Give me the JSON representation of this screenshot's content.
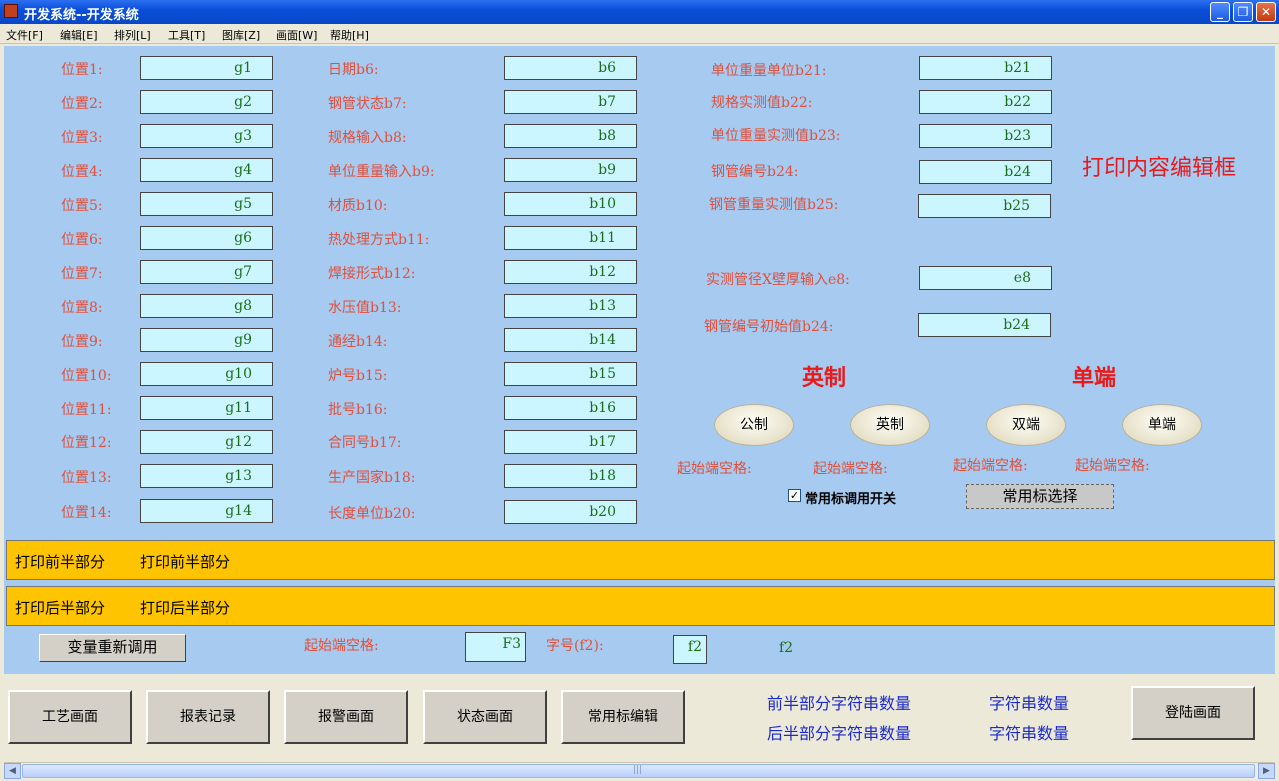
{
  "window": {
    "title": "开发系统--开发系统",
    "min": "_",
    "max": "❐",
    "close": "✕"
  },
  "menu": [
    "文件[F]",
    "编辑[E]",
    "排列[L]",
    "工具[T]",
    "图库[Z]",
    "画面[W]",
    "帮助[H]"
  ],
  "col1": [
    {
      "label": "位置1:",
      "value": "g1"
    },
    {
      "label": "位置2:",
      "value": "g2"
    },
    {
      "label": "位置3:",
      "value": "g3"
    },
    {
      "label": "位置4:",
      "value": "g4"
    },
    {
      "label": "位置5:",
      "value": "g5"
    },
    {
      "label": "位置6:",
      "value": "g6"
    },
    {
      "label": "位置7:",
      "value": "g7"
    },
    {
      "label": "位置8:",
      "value": "g8"
    },
    {
      "label": "位置9:",
      "value": "g9"
    },
    {
      "label": "位置10:",
      "value": "g10"
    },
    {
      "label": "位置11:",
      "value": "g11"
    },
    {
      "label": "位置12:",
      "value": "g12"
    },
    {
      "label": "位置13:",
      "value": "g13"
    },
    {
      "label": "位置14:",
      "value": "g14"
    }
  ],
  "col2": [
    {
      "label": "日期b6:",
      "value": "b6"
    },
    {
      "label": "钢管状态b7:",
      "value": "b7"
    },
    {
      "label": "规格输入b8:",
      "value": "b8"
    },
    {
      "label": "单位重量输入b9:",
      "value": "b9"
    },
    {
      "label": "材质b10:",
      "value": "b10"
    },
    {
      "label": "热处理方式b11:",
      "value": "b11"
    },
    {
      "label": "焊接形式b12:",
      "value": "b12"
    },
    {
      "label": "水压值b13:",
      "value": "b13"
    },
    {
      "label": "通经b14:",
      "value": "b14"
    },
    {
      "label": "炉号b15:",
      "value": "b15"
    },
    {
      "label": "批号b16:",
      "value": "b16"
    },
    {
      "label": "合同号b17:",
      "value": "b17"
    },
    {
      "label": "生产国家b18:",
      "value": "b18"
    },
    {
      "label": "长度单位b20:",
      "value": "b20"
    }
  ],
  "col3": [
    {
      "label": "单位重量单位b21:",
      "value": "b21"
    },
    {
      "label": "规格实测值b22:",
      "value": "b22"
    },
    {
      "label": "单位重量实测值b23:",
      "value": "b23"
    },
    {
      "label": "钢管编号b24:",
      "value": "b24"
    },
    {
      "label": "钢管重量实测值b25:",
      "value": "b25"
    },
    {
      "label": "实测管径X壁厚输入e8:",
      "value": "e8"
    },
    {
      "label": "钢管编号初始值b24:",
      "value": "b24"
    }
  ],
  "editor_title": "打印内容编辑框",
  "unit_title": "英制",
  "end_title": "单端",
  "ovals": [
    "公制",
    "英制",
    "双端",
    "单端"
  ],
  "space_labels": [
    "起始端空格:",
    "起始端空格:",
    "起始端空格:",
    "起始端空格:"
  ],
  "checkbox": {
    "label": "常用标调用开关",
    "mark": "✓"
  },
  "select_button": "常用标选择",
  "band_front": {
    "a": "打印前半部分",
    "b": "打印前半部分"
  },
  "band_back": {
    "a": "打印后半部分",
    "b": "打印后半部分"
  },
  "bottom": {
    "reload_button": "变量重新调用",
    "space_label": "起始端空格:",
    "space_value": "F3",
    "font_label": "字号(f2):",
    "font_value": "f2",
    "font_readout": "f2"
  },
  "nav_buttons": [
    "工艺画面",
    "报表记录",
    "报警画面",
    "状态画面",
    "常用标编辑"
  ],
  "counts": {
    "front_label": "前半部分字符串数量",
    "front_value": "字符串数量",
    "back_label": "后半部分字符串数量",
    "back_value": "字符串数量"
  },
  "login_button": "登陆画面",
  "scroll": {
    "left": "◀",
    "right": "▶",
    "grip": "|||"
  }
}
